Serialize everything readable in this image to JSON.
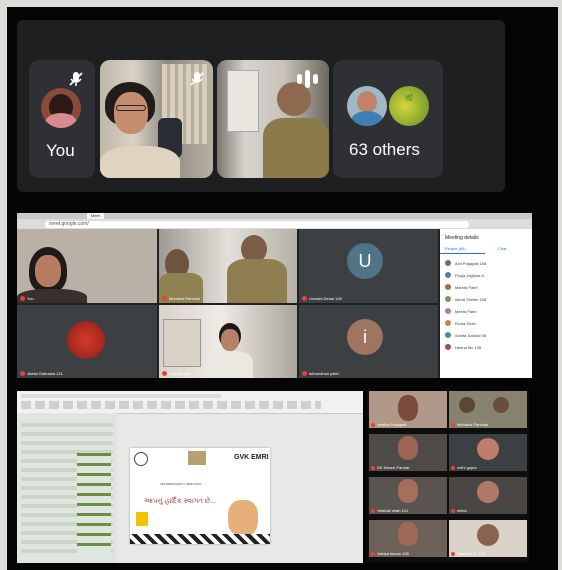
{
  "call_strip": {
    "tiles": [
      {
        "caption": "You"
      },
      {
        "caption": ""
      },
      {
        "caption": ""
      },
      {
        "caption": "63 others"
      }
    ]
  },
  "meet": {
    "browser": {
      "tab": "Meet",
      "url": "meet.google.com/"
    },
    "participants": [
      {
        "name": "You"
      },
      {
        "name": "Mrindula Panchal"
      },
      {
        "name": "Urvashi Desai 108"
      },
      {
        "name": "Jeetal Gabrawa 121"
      },
      {
        "name": "Vaishal Jain"
      },
      {
        "name": "Ishrandhsa patel"
      }
    ],
    "tile_letters": [
      "U",
      "i"
    ],
    "panel": {
      "title": "Meeting details",
      "tab_people": "People (64)",
      "tab_chat": "Chat",
      "rows": [
        "Anil Prajapati 108",
        "Pooja Jaghela 8",
        "Mamta Patel",
        "Ishrat Sheikh 108",
        "Meeta Patel",
        "Richa Shah",
        "Sunita Solanki 08",
        "Heena Mo 108"
      ]
    }
  },
  "presentation": {
    "slide_brand": "GVK EMRI",
    "slide_subtitle": "108 EMERGENCY SERVICES",
    "slide_heading": "આપનું હાર્દિક સ્વાગત છે..."
  },
  "gallery": {
    "names": [
      "Varsha Prajapati",
      "Mrindula Panchal",
      "DK Minaxi Parmar",
      "nidhi gupta",
      "Vaishali shah 121",
      "shina",
      "Vaidya kanan 108",
      "Sparsha 14 108"
    ]
  },
  "colors": {
    "meet_bg": "#202124",
    "tile_bg": "#3c4043",
    "mic_off": "#e94235",
    "accent": "#1a73e8"
  }
}
